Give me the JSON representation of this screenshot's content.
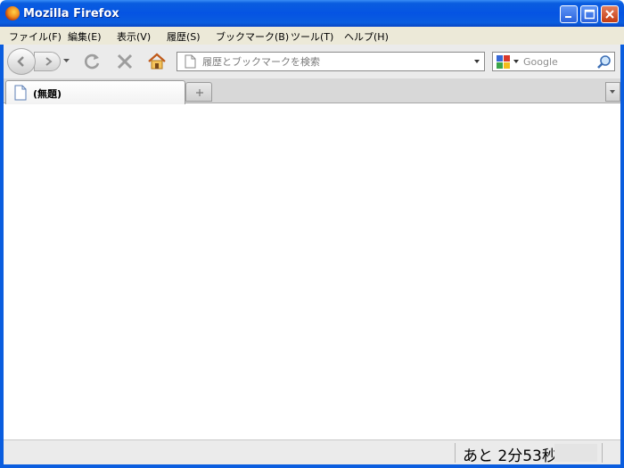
{
  "window": {
    "title": "Mozilla Firefox"
  },
  "menu": {
    "items": [
      "ファイル(F)",
      "編集(E)",
      "表示(V)",
      "履歴(S)",
      "ブックマーク(B)",
      "ツール(T)",
      "ヘルプ(H)"
    ]
  },
  "toolbar": {
    "url_placeholder": "履歴とブックマークを検索",
    "search_placeholder": "Google"
  },
  "tabs": [
    {
      "title": "(無題)"
    }
  ],
  "status": {
    "text": "あと 2分53秒"
  },
  "icons": {
    "app": "firefox-icon",
    "back": "back-arrow-icon",
    "forward": "forward-arrow-icon",
    "reload": "reload-icon",
    "stop": "stop-icon",
    "home": "home-icon",
    "page": "page-icon",
    "search": "magnifier-icon",
    "engine": "google-icon"
  }
}
